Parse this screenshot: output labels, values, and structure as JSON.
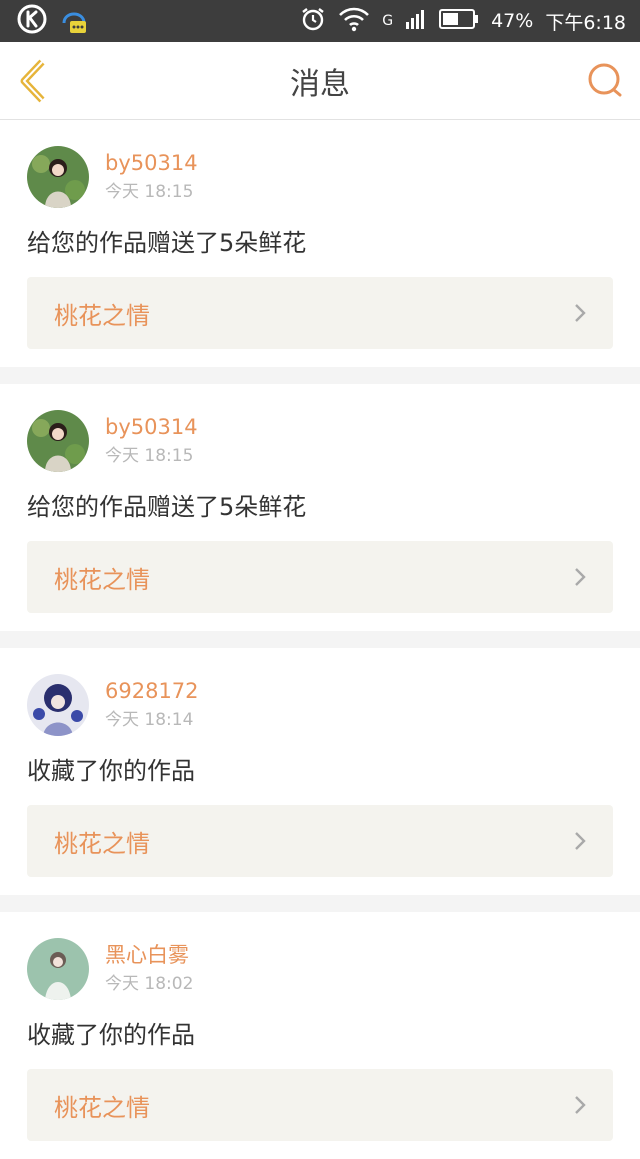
{
  "status_bar": {
    "battery": "47%",
    "time": "下午6:18",
    "network": "G"
  },
  "header": {
    "title": "消息"
  },
  "messages": [
    {
      "username": "by50314",
      "time": "今天 18:15",
      "action": "给您的作品赠送了5朵鲜花",
      "work": "桃花之情",
      "avatar_colors": [
        "#5f8a4a",
        "#d9d4c6"
      ]
    },
    {
      "username": "by50314",
      "time": "今天 18:15",
      "action": "给您的作品赠送了5朵鲜花",
      "work": "桃花之情",
      "avatar_colors": [
        "#5f8a4a",
        "#d9d4c6"
      ]
    },
    {
      "username": "6928172",
      "time": "今天 18:14",
      "action": "收藏了你的作品",
      "work": "桃花之情",
      "avatar_colors": [
        "#2a2f6e",
        "#e6e7f0"
      ]
    },
    {
      "username": "黑心白雾",
      "time": "今天 18:02",
      "action": "收藏了你的作品",
      "work": "桃花之情",
      "avatar_colors": [
        "#9cc3ad",
        "#eef2ee"
      ]
    }
  ],
  "colors": {
    "accent": "#e8935a",
    "back_icon": "#e6b43a",
    "status_bar_bg": "#3d3d3d"
  }
}
